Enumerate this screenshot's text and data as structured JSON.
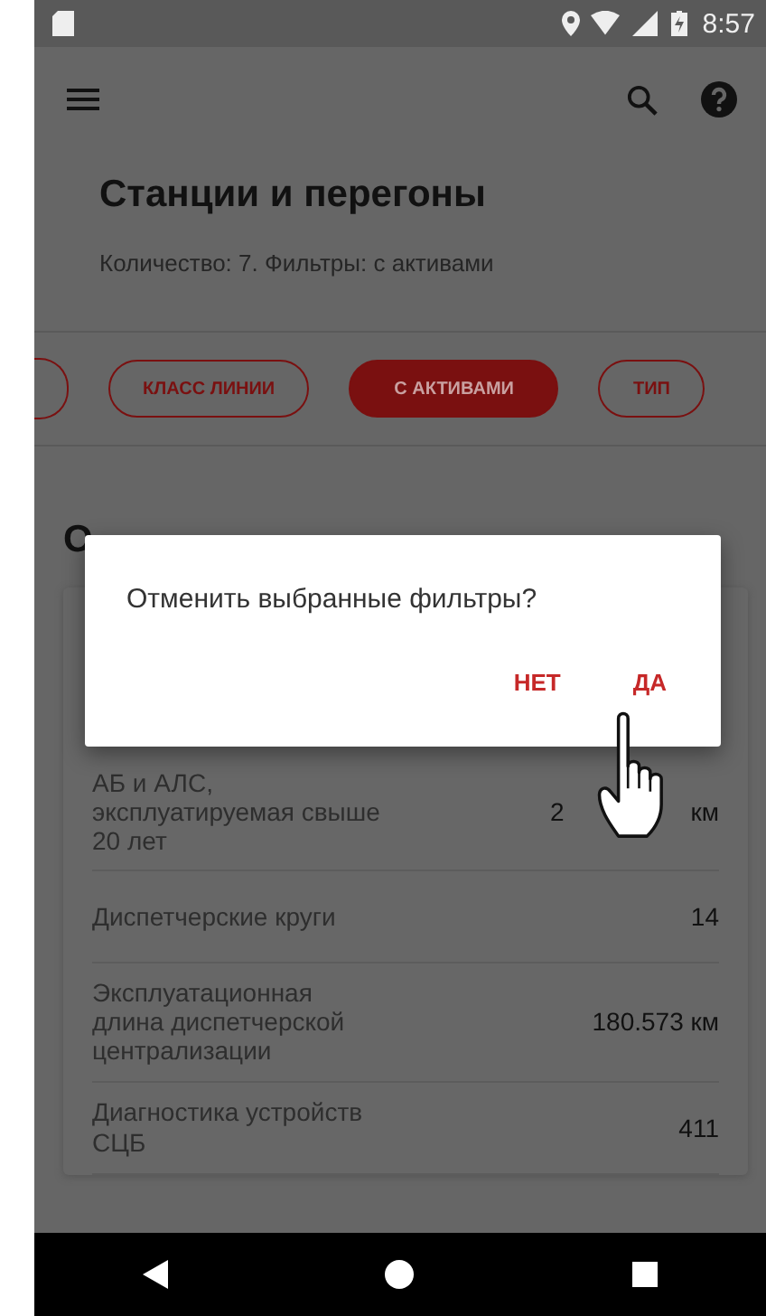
{
  "status_bar": {
    "time": "8:57"
  },
  "app_bar": {
    "title": "Станции и перегоны",
    "subtitle": "Количество: 7.  Фильтры: с активами"
  },
  "chips": [
    {
      "label": "КЛАСС ЛИНИИ",
      "selected": false
    },
    {
      "label": "С АКТИВАМИ",
      "selected": true
    },
    {
      "label": "ТИП",
      "selected": false
    }
  ],
  "section_heading": "О",
  "rows": [
    {
      "label": "АБ и АЛС, эксплуатируемая свыше 20 лет",
      "value": "2",
      "unit": "км"
    },
    {
      "label": "Диспетчерские круги",
      "value": "14"
    },
    {
      "label": "Эксплуатационная длина диспетчерской централизации",
      "value": "180.573 км"
    },
    {
      "label": "Диагностика устройств СЦБ",
      "value": "411"
    }
  ],
  "dialog": {
    "message": "Отменить выбранные фильтры?",
    "buttons": [
      "НЕТ",
      "ДА"
    ]
  }
}
